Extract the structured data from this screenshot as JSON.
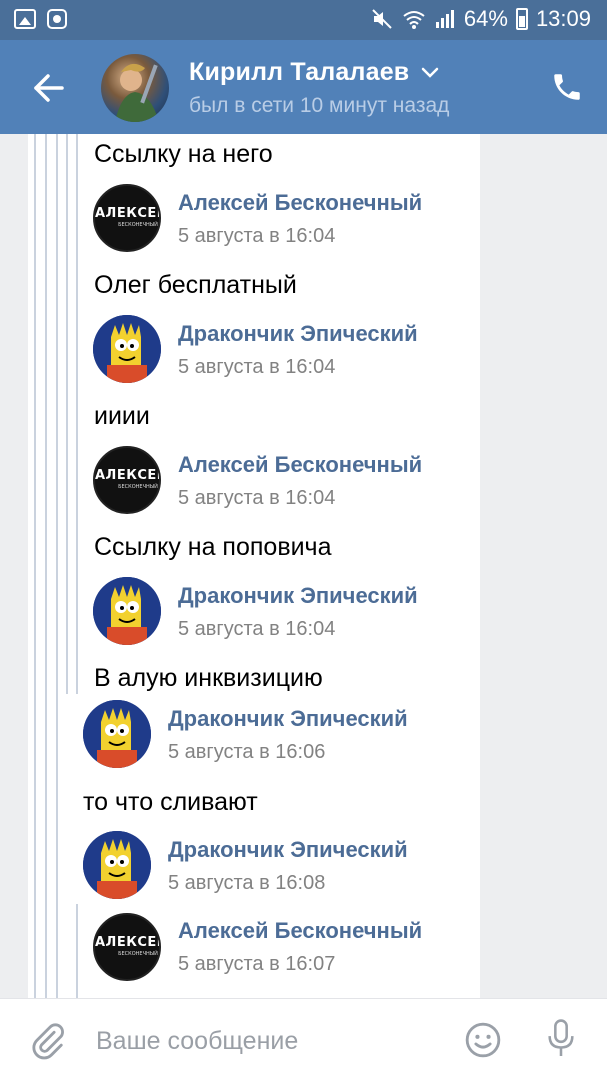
{
  "status_bar": {
    "battery": "64%",
    "time": "13:09",
    "icons": [
      "image-icon",
      "shield-app-icon",
      "mute-icon",
      "wifi-icon",
      "signal-icon",
      "battery-icon"
    ]
  },
  "header": {
    "name": "Кирилл Талалаев",
    "status": "был в сети 10 минут назад",
    "icons": [
      "back-arrow-icon",
      "chevron-down-icon",
      "phone-icon"
    ]
  },
  "chat": {
    "top_text": "Ссылку на него",
    "forwards": [
      {
        "author": "Алексей Бесконечный",
        "time": "5 августа в 16:04",
        "text": "Олег бесплатный",
        "avatar": "aleksei"
      },
      {
        "author": "Дракончик Эпический",
        "time": "5 августа в 16:04",
        "text": "ииии",
        "avatar": "bart"
      },
      {
        "author": "Алексей Бесконечный",
        "time": "5 августа в 16:04",
        "text": "Ссылку на поповича",
        "avatar": "aleksei"
      },
      {
        "author": "Дракончик Эпический",
        "time": "5 августа в 16:04",
        "text": "В алую инквизицию",
        "avatar": "bart"
      },
      {
        "author": "Дракончик Эпический",
        "time": "5 августа в 16:06",
        "text": "то что сливают",
        "avatar": "bart"
      },
      {
        "author": "Дракончик Эпический",
        "time": "5 августа в 16:08",
        "text": "",
        "avatar": "bart"
      },
      {
        "author": "Алексей Бесконечный",
        "time": "5 августа в 16:07",
        "text": "",
        "avatar": "aleksei"
      }
    ],
    "aleksei_logo": {
      "word": "АЛЕКСЕЙ",
      "sub": "БЕСКОНЕЧНЫЙ"
    }
  },
  "input": {
    "placeholder": "Ваше сообщение",
    "icons": [
      "paperclip-icon",
      "emoji-icon",
      "microphone-icon"
    ]
  },
  "colors": {
    "header": "#5181b8",
    "status_bar": "#4a6f99",
    "link_name": "#4c6c96",
    "time": "#828282"
  }
}
